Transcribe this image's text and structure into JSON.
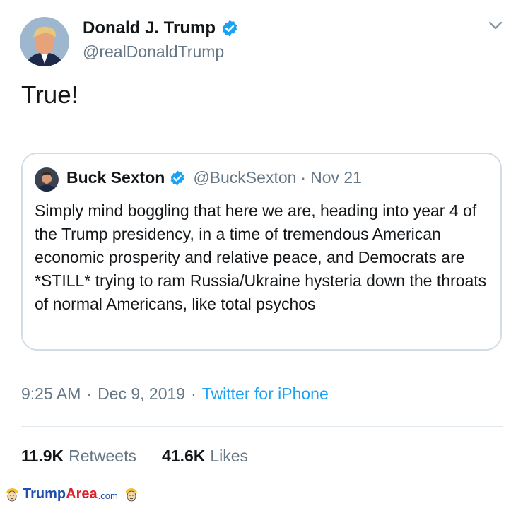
{
  "tweet": {
    "display_name": "Donald J. Trump",
    "handle": "@realDonaldTrump",
    "text": "True!",
    "avatar_icon": "user-avatar",
    "verified_icon": "verified-badge",
    "menu_icon": "chevron-down"
  },
  "quoted": {
    "display_name": "Buck Sexton",
    "handle": "@BuckSexton",
    "separator": "·",
    "date": "Nov 21",
    "body": "Simply mind boggling that here we are, heading into year 4 of the Trump presidency, in a time of tremendous American economic prosperity and relative peace, and Democrats are *STILL* trying to ram Russia/Ukraine hysteria down the throats of normal Americans, like total psychos"
  },
  "meta": {
    "time": "9:25 AM",
    "separator": "·",
    "date": "Dec 9, 2019",
    "source": "Twitter for iPhone"
  },
  "stats": {
    "retweets_count": "11.9K",
    "retweets_label": "Retweets",
    "likes_count": "41.6K",
    "likes_label": "Likes"
  },
  "watermark": {
    "part1": "Trump",
    "part2": "Area",
    "part3": ".com"
  },
  "colors": {
    "accent": "#1da1f2",
    "secondary_text": "#657786",
    "primary_text": "#14171a",
    "border": "#d3dce4"
  }
}
